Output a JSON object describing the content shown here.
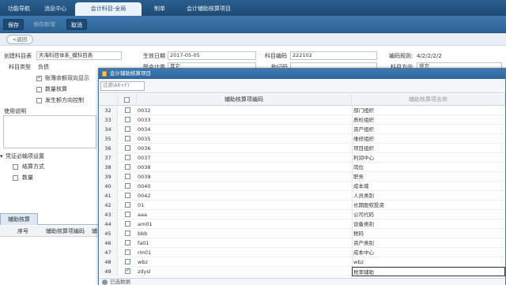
{
  "top_tabs": [
    "功能导航",
    "消息中心",
    "会计科目-全局",
    "制单",
    "会计辅助核算项目"
  ],
  "toolbar": {
    "save": "保存",
    "save_add": "保存新增",
    "cancel": "取消"
  },
  "back_label": "<返回",
  "form": {
    "subject_table_label": "创建科目表",
    "subject_table_value": "天海科目体系_模科目表",
    "subject_type_label": "科目类型",
    "subject_type_value": "负债",
    "effective_date_label": "生效日期",
    "effective_date_value": "2017-05-05",
    "subject_code_label": "科目编码",
    "subject_code_value": "222102",
    "code_rule_label": "编码规则:",
    "code_rule_value": "4/2/2/2/2",
    "row2_label": "所会计类",
    "row2_value": "其它",
    "mnemonic_label": "助记码",
    "direction_label": "科目方向",
    "direction_value": "贷方",
    "checkboxes": [
      {
        "label": "账簿余额双向显示",
        "checked": true
      },
      {
        "label": "数量核算",
        "checked": false
      },
      {
        "label": "发生额方向控制",
        "checked": false
      }
    ],
    "remark_label": "使用说明",
    "voucher_section_label": "凭证必输项设置",
    "voucher_items": [
      "结算方式",
      "数量"
    ]
  },
  "subtab": {
    "label": "辅助核算",
    "columns": [
      "序号",
      "辅助核算项编码",
      "辅"
    ]
  },
  "dialog": {
    "title": "会计辅助核算项目",
    "filter_placeholder": "过滤(Alt+F)",
    "columns": [
      "辅助核算项编码",
      "辅助核算项名称"
    ],
    "rows": [
      {
        "num": "32",
        "code": "0032",
        "name": "部门组织",
        "checked": false
      },
      {
        "num": "33",
        "code": "0033",
        "name": "质检组织",
        "checked": false
      },
      {
        "num": "34",
        "code": "0034",
        "name": "资产组织",
        "checked": false
      },
      {
        "num": "35",
        "code": "0035",
        "name": "维修组织",
        "checked": false
      },
      {
        "num": "36",
        "code": "0036",
        "name": "项目组织",
        "checked": false
      },
      {
        "num": "37",
        "code": "0037",
        "name": "利润中心",
        "checked": false
      },
      {
        "num": "38",
        "code": "0038",
        "name": "岗位",
        "checked": false
      },
      {
        "num": "39",
        "code": "0039",
        "name": "职务",
        "checked": false
      },
      {
        "num": "40",
        "code": "0040",
        "name": "成本域",
        "checked": false
      },
      {
        "num": "41",
        "code": "0042",
        "name": "人员类别",
        "checked": false
      },
      {
        "num": "42",
        "code": "01",
        "name": "长期股权投资",
        "checked": false
      },
      {
        "num": "43",
        "code": "aaa",
        "name": "公司代码",
        "checked": false
      },
      {
        "num": "44",
        "code": "am01",
        "name": "设备类别",
        "checked": false
      },
      {
        "num": "45",
        "code": "bbb",
        "name": "税码",
        "checked": false
      },
      {
        "num": "46",
        "code": "fa01",
        "name": "资产类别",
        "checked": false
      },
      {
        "num": "47",
        "code": "rm01",
        "name": "成本中心",
        "checked": false
      },
      {
        "num": "48",
        "code": "wbz",
        "name": "wbz",
        "checked": false
      },
      {
        "num": "49",
        "code": "zdysl",
        "name": "税率辅助",
        "checked": true
      }
    ],
    "footer": "已选数据"
  }
}
